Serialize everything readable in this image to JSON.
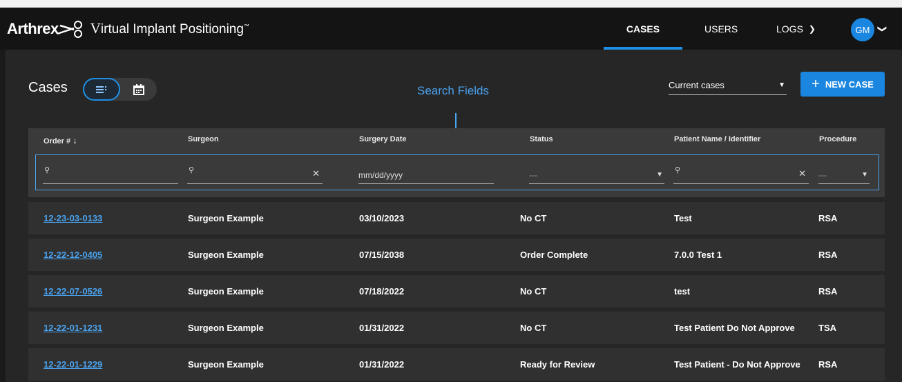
{
  "header": {
    "logo_text": "Arthrex",
    "app_name_initial": "V",
    "app_name_rest": "irtual Implant Positioning",
    "nav": [
      {
        "label": "CASES",
        "active": true
      },
      {
        "label": "USERS"
      },
      {
        "label": "LOGS"
      }
    ],
    "avatar_initials": "GM",
    "accent_color": "#1f8fe6"
  },
  "page": {
    "title": "Cases",
    "annotation": "Search Fields",
    "filter_select": "Current cases",
    "new_case_label": "NEW CASE"
  },
  "table": {
    "columns": [
      "Order #",
      "Surgeon",
      "Surgery Date",
      "Status",
      "Patient Name / Identifier",
      "Procedure"
    ],
    "search": {
      "date_placeholder": "mm/dd/yyyy",
      "status_value": "---",
      "procedure_value": "---"
    },
    "rows": [
      {
        "order": "12-23-03-0133",
        "surgeon": "Surgeon Example",
        "date": "03/10/2023",
        "status": "No CT",
        "patient": "Test",
        "procedure": "RSA"
      },
      {
        "order": "12-22-12-0405",
        "surgeon": "Surgeon Example",
        "date": "07/15/2038",
        "status": "Order Complete",
        "patient": "7.0.0 Test 1",
        "procedure": "RSA"
      },
      {
        "order": "12-22-07-0526",
        "surgeon": "Surgeon Example",
        "date": "07/18/2022",
        "status": "No CT",
        "patient": "test",
        "procedure": "RSA"
      },
      {
        "order": "12-22-01-1231",
        "surgeon": "Surgeon Example",
        "date": "01/31/2022",
        "status": "No CT",
        "patient": "Test Patient Do Not Approve",
        "procedure": "TSA"
      },
      {
        "order": "12-22-01-1229",
        "surgeon": "Surgeon Example",
        "date": "01/31/2022",
        "status": "Ready for Review",
        "patient": "Test Patient - Do Not Approve",
        "procedure": "RSA"
      }
    ]
  }
}
